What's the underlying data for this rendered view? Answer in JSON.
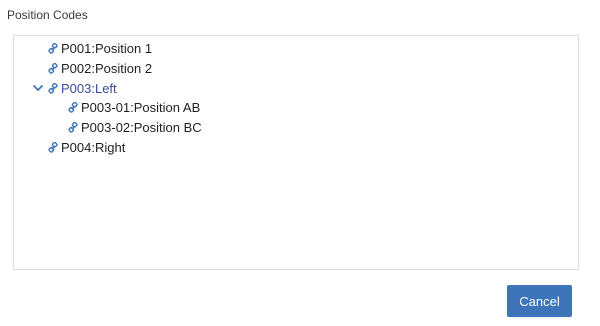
{
  "panel": {
    "label": "Position Codes"
  },
  "tree": {
    "nodes": [
      {
        "label": "P001:Position 1"
      },
      {
        "label": "P002:Position 2"
      },
      {
        "label": "P003:Left",
        "expanded": true,
        "selected": true,
        "children": [
          {
            "label": "P003-01:Position AB"
          },
          {
            "label": "P003-02:Position BC"
          }
        ]
      },
      {
        "label": "P004:Right"
      }
    ],
    "icon": "link-icon",
    "expand_icon": "chevron-down-icon"
  },
  "footer": {
    "cancel_label": "Cancel"
  },
  "colors": {
    "accent": "#3e74b9",
    "selected_text": "#3a4a9c",
    "icon": "#3f73b5"
  }
}
